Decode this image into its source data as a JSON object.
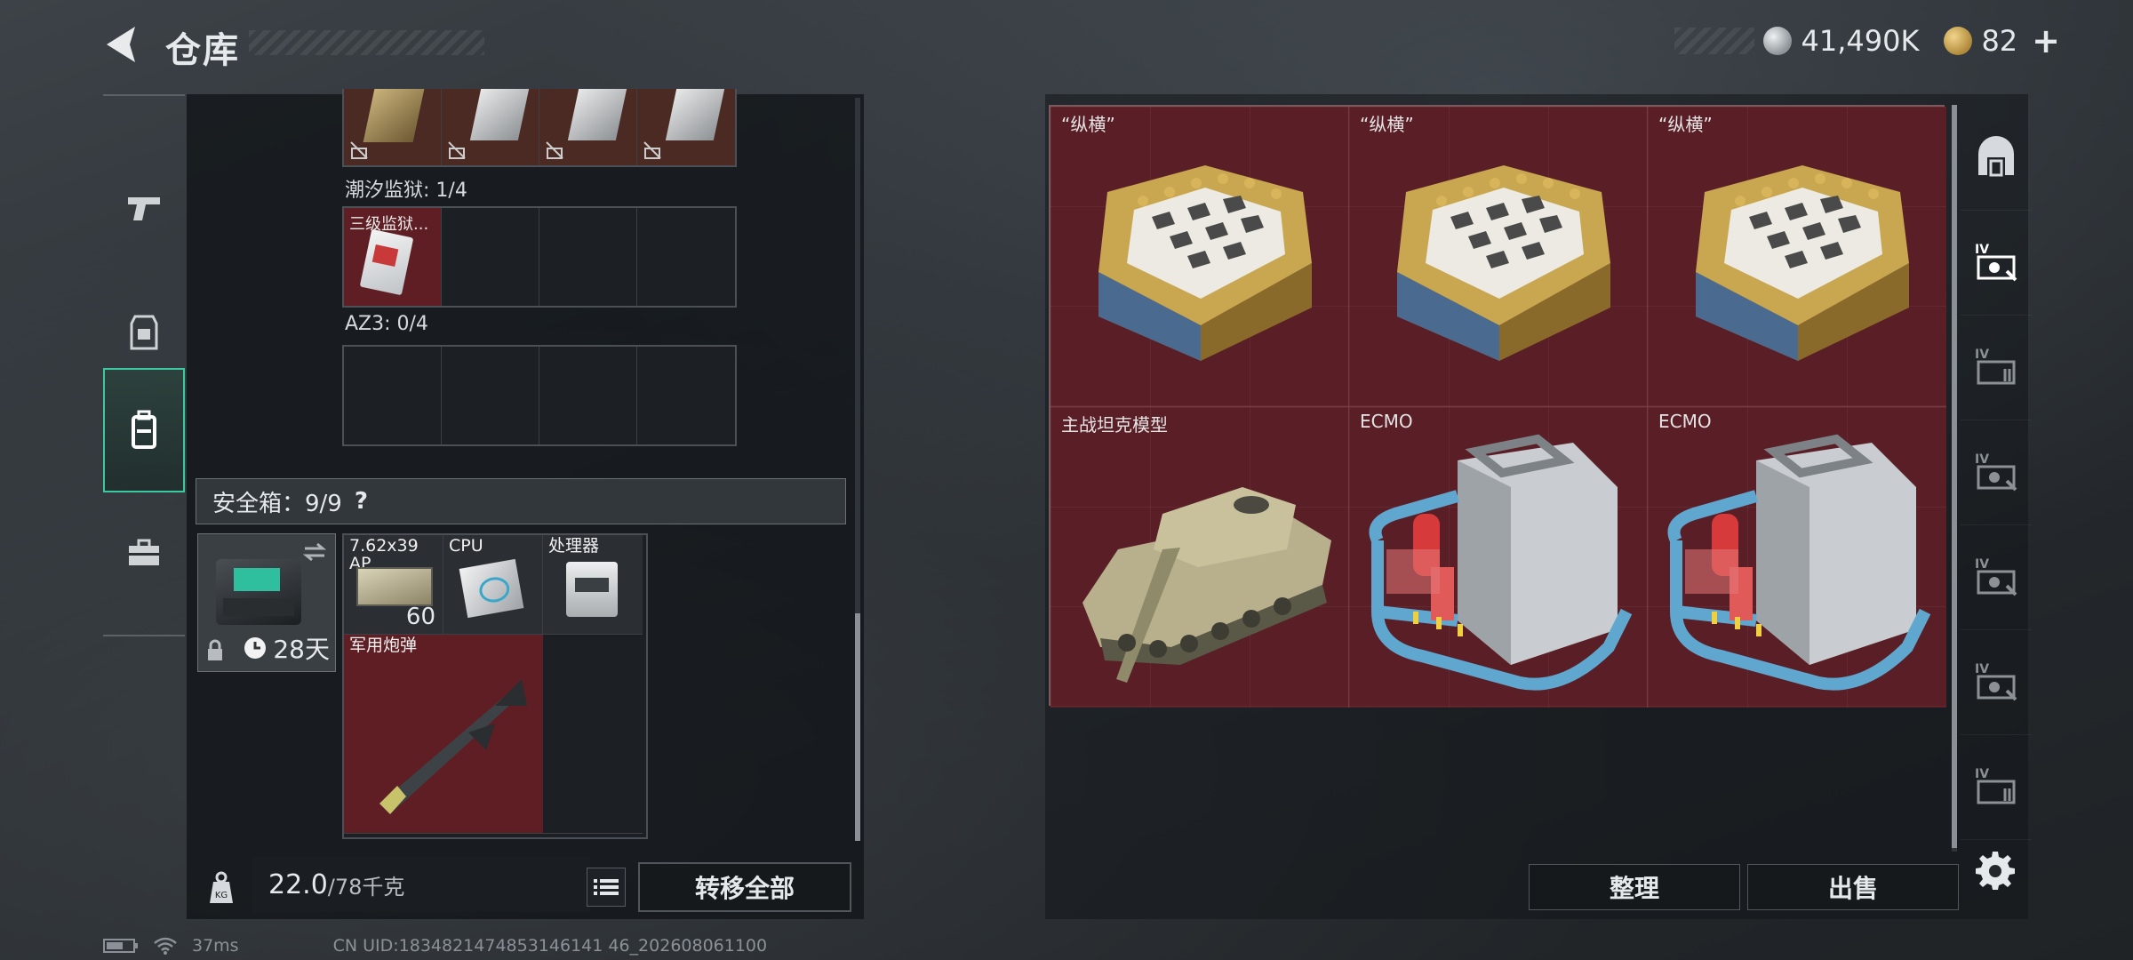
{
  "header": {
    "title": "仓库",
    "currency": [
      {
        "icon": "silver-coin-icon",
        "value": "41,490K"
      },
      {
        "icon": "gold-triangle-coin-icon",
        "value": "82"
      }
    ],
    "plus_label": "+"
  },
  "left_tabs": [
    {
      "icon": "pistol-icon",
      "active": false
    },
    {
      "icon": "armor-vest-icon",
      "active": false
    },
    {
      "icon": "backpack-icon",
      "active": true
    },
    {
      "icon": "briefcase-icon",
      "active": false
    }
  ],
  "containers": [
    {
      "label": "潮汐监狱: 1/4",
      "items": [
        {
          "name": "三级监狱..."
        }
      ]
    },
    {
      "label": "AZ3: 0/4",
      "items": []
    }
  ],
  "safe": {
    "label": "安全箱：9/9",
    "help": "?",
    "days": "28天",
    "items": [
      {
        "name": "7.62x39 AP",
        "count": "60"
      },
      {
        "name": "CPU"
      },
      {
        "name": "处理器"
      },
      {
        "name": "军用炮弹"
      }
    ]
  },
  "footer": {
    "weight": "22.0",
    "weight_max": "/78千克",
    "transfer_label": "转移全部"
  },
  "stash": {
    "items": [
      {
        "name": "“纵横”",
        "kind": "chess"
      },
      {
        "name": "“纵横”",
        "kind": "chess"
      },
      {
        "name": "“纵横”",
        "kind": "chess"
      },
      {
        "name": "主战坦克模型",
        "kind": "tank"
      },
      {
        "name": "ECMO",
        "kind": "ecmo"
      },
      {
        "name": "ECMO",
        "kind": "ecmo"
      }
    ],
    "sort_label": "整理",
    "sell_label": "出售"
  },
  "side_tabs": [
    {
      "icon": "vault-icon"
    },
    {
      "icon": "tier-iv-case-icon",
      "tier": "IV"
    },
    {
      "icon": "tier-iv-case-icon",
      "tier": "IV"
    },
    {
      "icon": "tier-iv-case-icon",
      "tier": "IV"
    },
    {
      "icon": "tier-iv-case-icon",
      "tier": "IV"
    },
    {
      "icon": "tier-iv-case-icon",
      "tier": "IV"
    },
    {
      "icon": "tier-iv-case-icon",
      "tier": "IV"
    }
  ],
  "status": {
    "ping": "37ms",
    "uid": "CN UID:1834821474853146141 46_202608061100"
  }
}
